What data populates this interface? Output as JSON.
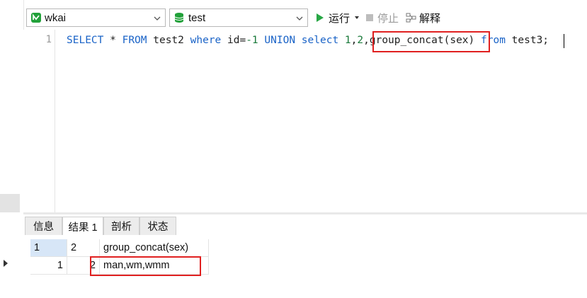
{
  "toolbar": {
    "connection": "wkai",
    "database": "test",
    "run_label": "运行",
    "stop_label": "停止",
    "explain_label": "解释"
  },
  "editor": {
    "line_number": "1",
    "tokens": {
      "t1": "SELECT",
      "t2": " * ",
      "t3": "FROM",
      "t4": " test2 ",
      "t5": "where",
      "t6": " id=",
      "t7": "-1",
      "t8": " ",
      "t9": "UNION",
      "t10": " ",
      "t11": "select",
      "t12": " ",
      "t13": "1",
      "t14": ",",
      "t15": "2",
      "t16": ",group_concat(sex) ",
      "t17": "from",
      "t18": " test3;"
    }
  },
  "results": {
    "tabs": [
      "信息",
      "结果 1",
      "剖析",
      "状态"
    ],
    "columns": [
      "1",
      "2",
      "group_concat(sex)"
    ],
    "rows": [
      [
        "1",
        "2",
        "man,wm,wmm"
      ]
    ]
  },
  "colors": {
    "keyword": "#1a63c7",
    "number": "#1a7a3a",
    "highlight": "#e02020",
    "run": "#28a745"
  }
}
